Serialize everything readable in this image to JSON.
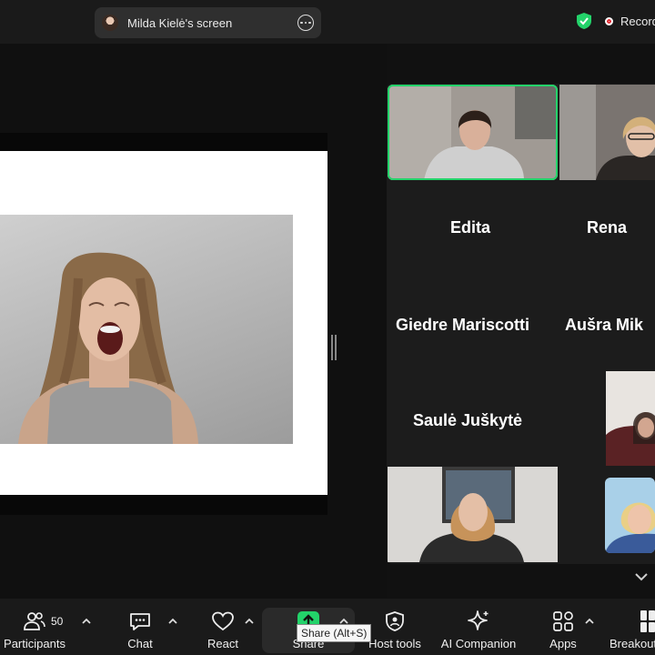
{
  "topbar": {
    "screen_share_label": "Milda Kielė's screen",
    "recording_label": "Recording"
  },
  "gallery": {
    "tiles": [
      {
        "name": "Edita"
      },
      {
        "name": "Rena"
      },
      {
        "name": "Giedre Mariscotti"
      },
      {
        "name": "Aušra  Mik"
      },
      {
        "name": "Saulė Juškytė"
      }
    ]
  },
  "toolbar": {
    "participants_label": "Participants",
    "participants_count": "50",
    "chat_label": "Chat",
    "react_label": "React",
    "share_label": "Share",
    "share_tooltip": "Share (Alt+S)",
    "host_tools_label": "Host tools",
    "ai_companion_label": "AI Companion",
    "apps_label": "Apps",
    "breakout_label": "Breakout"
  },
  "colors": {
    "accent_green": "#23d36a",
    "record_red": "#e0262e",
    "toolbar_bg": "#1a1a1a"
  },
  "icons": [
    "participants-icon",
    "chat-icon",
    "heart-icon",
    "share-arrow-icon",
    "shield-icon",
    "sparkle-icon",
    "apps-icon",
    "breakout-icon",
    "more-icon",
    "chevron-up-icon",
    "chevron-down-icon"
  ]
}
